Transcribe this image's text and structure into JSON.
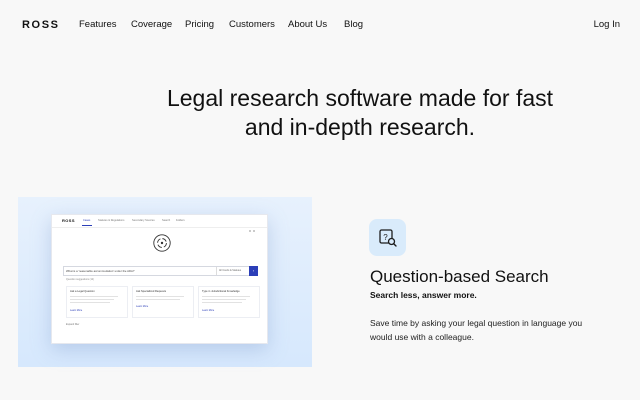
{
  "nav": {
    "logo": "ROSS",
    "items": [
      "Features",
      "Coverage",
      "Pricing",
      "Customers",
      "About Us",
      "Blog"
    ],
    "login": "Log In"
  },
  "hero": {
    "title_line1": "Legal research software made for fast",
    "title_line2": "and in-depth research."
  },
  "mockup": {
    "logo": "ROSS",
    "tabs": [
      "Cases",
      "Statutes & Regulations",
      "Secondary Sources",
      "Search",
      "Folders"
    ],
    "search_query": "What is a 'reasonable accommodation' under the ADA?",
    "filter": "All Courts & Statutes",
    "hint": "Question suggestions (12)",
    "cards": [
      {
        "title": "Ask a Legal Question",
        "link": "Learn More"
      },
      {
        "title": "Ask Specialized Requests",
        "link": "Learn More"
      },
      {
        "title": "Type in Jurisdictional Knowledge",
        "link": "Learn More"
      }
    ],
    "footer": "Expand filter"
  },
  "feature": {
    "icon": "question-search-icon",
    "title": "Question-based Search",
    "subtitle": "Search less, answer more.",
    "desc": "Save time by asking your legal question in language you would use with a colleague."
  },
  "colors": {
    "accent": "#2c3fb8",
    "icon_bg": "#d9ebfb",
    "panel_bg": "#dbeafd",
    "page_bg": "#f8f8f8"
  }
}
